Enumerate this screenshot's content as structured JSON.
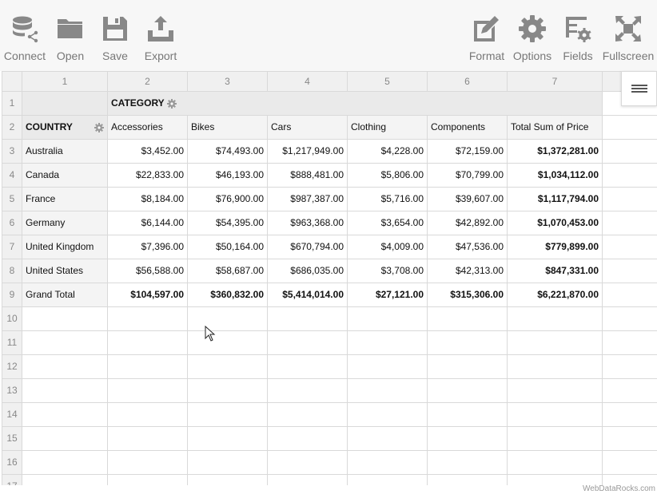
{
  "toolbar": {
    "connect": "Connect",
    "open": "Open",
    "save": "Save",
    "export": "Export",
    "format": "Format",
    "options": "Options",
    "fields": "Fields",
    "fullscreen": "Fullscreen"
  },
  "grid": {
    "col_numbers": [
      "1",
      "2",
      "3",
      "4",
      "5",
      "6",
      "7"
    ],
    "row_numbers": [
      "1",
      "2",
      "3",
      "4",
      "5",
      "6",
      "7",
      "8",
      "9",
      "10",
      "11",
      "12",
      "13",
      "14",
      "15",
      "16",
      "17"
    ],
    "category_label": "CATEGORY",
    "country_label": "COUNTRY",
    "headers": [
      "Accessories",
      "Bikes",
      "Cars",
      "Clothing",
      "Components",
      "Total Sum of Price"
    ],
    "rows": [
      {
        "country": "Australia",
        "values": [
          "$3,452.00",
          "$74,493.00",
          "$1,217,949.00",
          "$4,228.00",
          "$72,159.00",
          "$1,372,281.00"
        ]
      },
      {
        "country": "Canada",
        "values": [
          "$22,833.00",
          "$46,193.00",
          "$888,481.00",
          "$5,806.00",
          "$70,799.00",
          "$1,034,112.00"
        ]
      },
      {
        "country": "France",
        "values": [
          "$8,184.00",
          "$76,900.00",
          "$987,387.00",
          "$5,716.00",
          "$39,607.00",
          "$1,117,794.00"
        ]
      },
      {
        "country": "Germany",
        "values": [
          "$6,144.00",
          "$54,395.00",
          "$963,368.00",
          "$3,654.00",
          "$42,892.00",
          "$1,070,453.00"
        ]
      },
      {
        "country": "United Kingdom",
        "values": [
          "$7,396.00",
          "$50,164.00",
          "$670,794.00",
          "$4,009.00",
          "$47,536.00",
          "$779,899.00"
        ]
      },
      {
        "country": "United States",
        "values": [
          "$56,588.00",
          "$58,687.00",
          "$686,035.00",
          "$3,708.00",
          "$42,313.00",
          "$847,331.00"
        ]
      }
    ],
    "grand_total": {
      "label": "Grand Total",
      "values": [
        "$104,597.00",
        "$360,832.00",
        "$5,414,014.00",
        "$27,121.00",
        "$315,306.00",
        "$6,221,870.00"
      ]
    }
  },
  "credit": "WebDataRocks.com"
}
